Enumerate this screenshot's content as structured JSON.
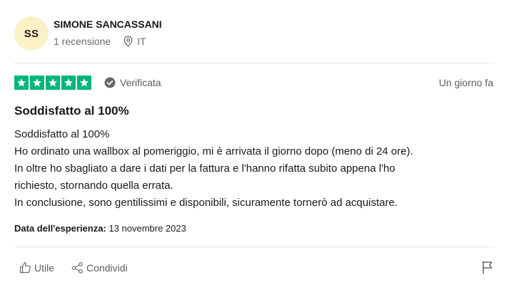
{
  "reviewer": {
    "initials": "SS",
    "name": "SIMONE SANCASSANI",
    "review_count": "1 recensione",
    "country": "IT",
    "avatar_color": "#fbf1c7"
  },
  "rating": {
    "stars": 5,
    "max_stars": 5,
    "star_color": "#00b67a",
    "verified_label": "Verificata",
    "date_posted": "Un giorno fa"
  },
  "review": {
    "title": "Soddisfatto al 100%",
    "lines": [
      "Soddisfatto al 100%",
      "Ho ordinato una wallbox al pomeriggio, mi è arrivata il giorno dopo (meno di 24 ore).",
      "In oltre ho sbagliato a dare i dati per la fattura e l'hanno rifatta subito appena l'ho",
      "richiesto, stornando quella errata.",
      "In conclusione, sono gentilissimi e disponibili, sicuramente tornerò ad acquistare."
    ],
    "experience_label": "Data dell'esperienza:",
    "experience_date": "13 novembre 2023"
  },
  "actions": {
    "useful_label": "Utile",
    "share_label": "Condividi"
  }
}
